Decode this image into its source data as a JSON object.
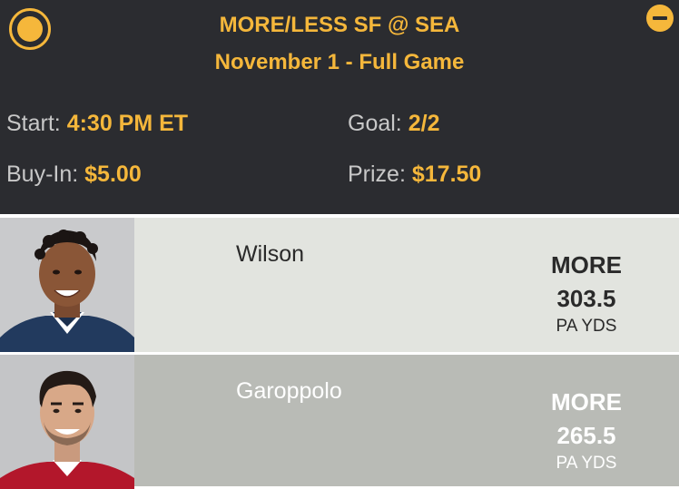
{
  "header": {
    "title": "MORE/LESS SF @ SEA",
    "subtitle": "November 1 - Full Game",
    "start_label": "Start:",
    "start_value": "4:30 PM ET",
    "goal_label": "Goal:",
    "goal_value": "2/2",
    "buyin_label": "Buy-In:",
    "buyin_value": "$5.00",
    "prize_label": "Prize:",
    "prize_value": "$17.50"
  },
  "picks": [
    {
      "player": "Wilson",
      "choice": "MORE",
      "line": "303.5",
      "stat": "PA YDS"
    },
    {
      "player": "Garoppolo",
      "choice": "MORE",
      "line": "265.5",
      "stat": "PA YDS"
    }
  ],
  "colors": {
    "accent": "#f5b73b",
    "header_bg": "#2b2c30",
    "row1_bg": "#e2e4df",
    "row2_bg": "#b9bbb6"
  }
}
